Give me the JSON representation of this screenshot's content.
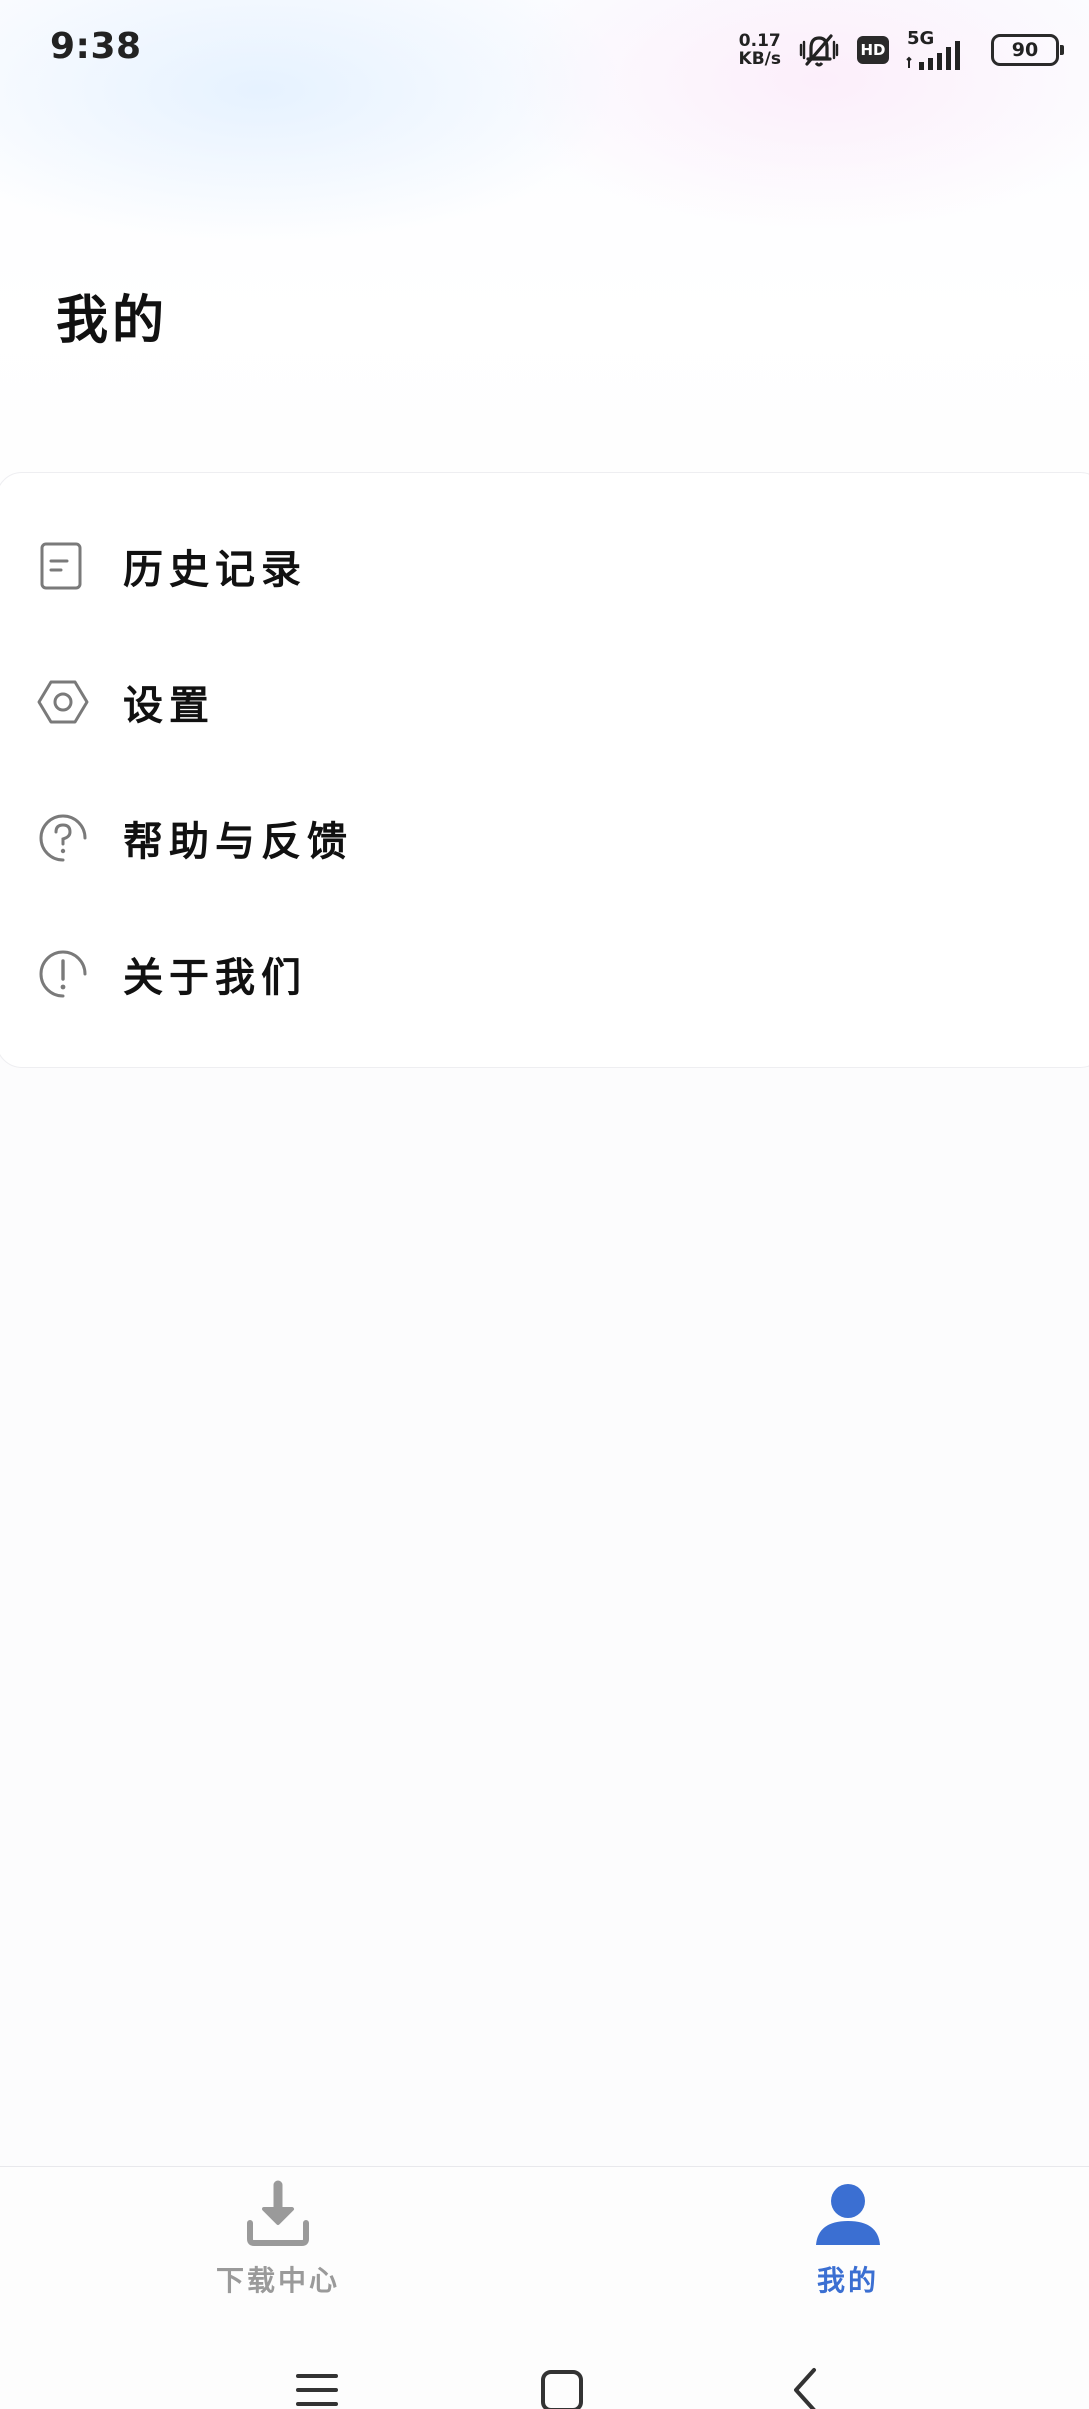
{
  "status_bar": {
    "time": "9:38",
    "net_speed_value": "0.17",
    "net_speed_unit": "KB/s",
    "hd_label": "HD",
    "network_type": "5G",
    "battery_level": "90",
    "icons": [
      "mute-bell-icon",
      "signal-icon",
      "battery-icon"
    ]
  },
  "header": {
    "title": "我的"
  },
  "menu": {
    "items": [
      {
        "label": "历史记录",
        "icon": "history-document-icon"
      },
      {
        "label": "设置",
        "icon": "settings-hexagon-icon"
      },
      {
        "label": "帮助与反馈",
        "icon": "help-question-icon"
      },
      {
        "label": "关于我们",
        "icon": "info-exclamation-icon"
      }
    ]
  },
  "bottom_nav": {
    "tabs": [
      {
        "label": "下载中心",
        "icon": "download-icon",
        "active": false
      },
      {
        "label": "我的",
        "icon": "user-icon",
        "active": true
      }
    ]
  },
  "colors": {
    "accent": "#3b6fd2",
    "inactive": "#9a9a9a",
    "icon_gray": "#7a7a7a"
  }
}
